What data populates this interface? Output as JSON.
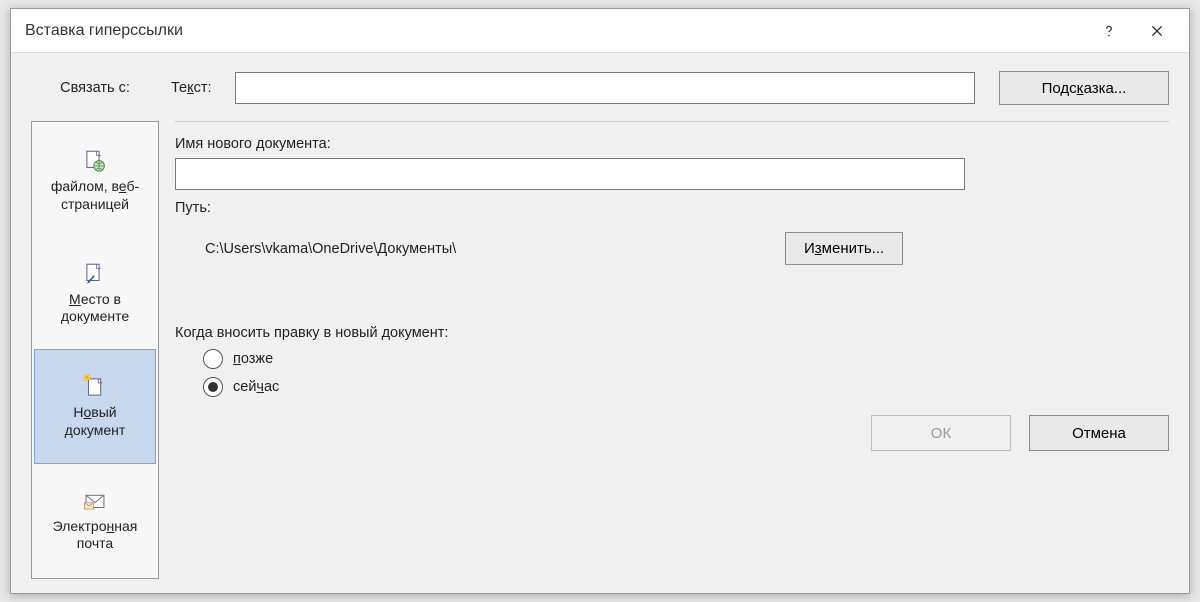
{
  "title": "Вставка гиперссылки",
  "link_with_label": "Связать с:",
  "text_label": "Текст:",
  "text_value": "",
  "hint_button": "Подсказка...",
  "sidebar": {
    "items": [
      {
        "line1": "файлом, веб-",
        "line2": "страницей"
      },
      {
        "line1": "Место в",
        "line2": "документе"
      },
      {
        "line1": "Новый",
        "line2": "документ"
      },
      {
        "line1": "Электронная",
        "line2": "почта"
      }
    ]
  },
  "new_doc_name_label": "Имя нового документа:",
  "new_doc_name_value": "",
  "path_label": "Путь:",
  "path_value": "C:\\Users\\vkama\\OneDrive\\Документы\\",
  "change_button": "Изменить...",
  "when_edit_label": "Когда вносить правку в новый документ:",
  "radio_later": "позже",
  "radio_now": "сейчас",
  "ok_button": "ОК",
  "cancel_button": "Отмена"
}
